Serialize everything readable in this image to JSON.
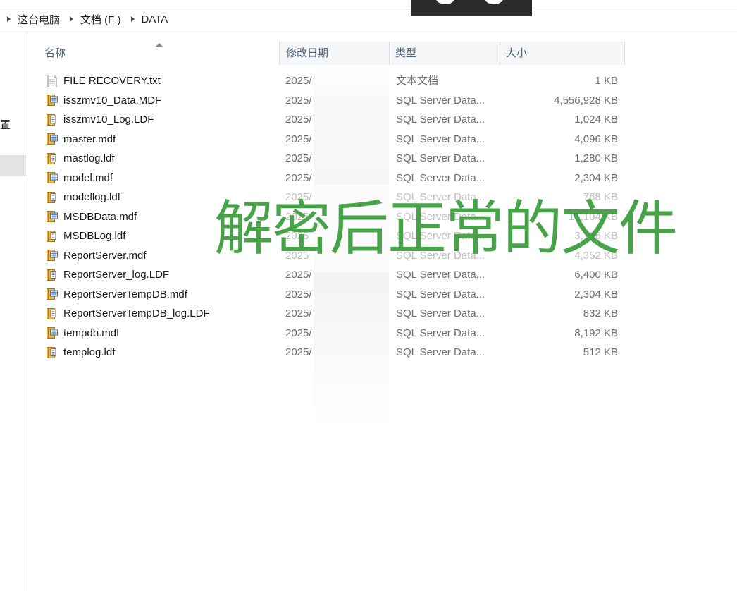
{
  "breadcrumb": [
    "这台电脑",
    "文档 (F:)",
    "DATA"
  ],
  "nav": {
    "partial_label": "置"
  },
  "columns": {
    "name": "名称",
    "date": "修改日期",
    "type": "类型",
    "size": "大小"
  },
  "files": [
    {
      "name": "FILE RECOVERY.txt",
      "date": "2025/",
      "type": "文本文档",
      "size": "1 KB",
      "icon": "text-file-icon"
    },
    {
      "name": "isszmv10_Data.MDF",
      "date": "2025/",
      "type": "SQL Server Data...",
      "size": "4,556,928 KB",
      "icon": "sql-data-file-icon"
    },
    {
      "name": "isszmv10_Log.LDF",
      "date": "2025/",
      "type": "SQL Server Data...",
      "size": "1,024 KB",
      "icon": "sql-log-file-icon"
    },
    {
      "name": "master.mdf",
      "date": "2025/",
      "type": "SQL Server Data...",
      "size": "4,096 KB",
      "icon": "sql-data-file-icon"
    },
    {
      "name": "mastlog.ldf",
      "date": "2025/",
      "type": "SQL Server Data...",
      "size": "1,280 KB",
      "icon": "sql-log-file-icon"
    },
    {
      "name": "model.mdf",
      "date": "2025/",
      "type": "SQL Server Data...",
      "size": "2,304 KB",
      "icon": "sql-data-file-icon"
    },
    {
      "name": "modellog.ldf",
      "date": "2025/",
      "type": "SQL Server Data...",
      "size": "768 KB",
      "icon": "sql-log-file-icon"
    },
    {
      "name": "MSDBData.mdf",
      "date": "2025",
      "type": "SQL Server Data...",
      "size": "15,104 KB",
      "icon": "sql-data-file-icon"
    },
    {
      "name": "MSDBLog.ldf",
      "date": "2025",
      "type": "SQL Server Data...",
      "size": "3,136 KB",
      "icon": "sql-log-file-icon"
    },
    {
      "name": "ReportServer.mdf",
      "date": "2025",
      "type": "SQL Server Data...",
      "size": "4,352 KB",
      "icon": "sql-data-file-icon"
    },
    {
      "name": "ReportServer_log.LDF",
      "date": "2025/",
      "type": "SQL Server Data...",
      "size": "6,400 KB",
      "icon": "sql-log-file-icon"
    },
    {
      "name": "ReportServerTempDB.mdf",
      "date": "2025/",
      "type": "SQL Server Data...",
      "size": "2,304 KB",
      "icon": "sql-data-file-icon"
    },
    {
      "name": "ReportServerTempDB_log.LDF",
      "date": "2025/",
      "type": "SQL Server Data...",
      "size": "832 KB",
      "icon": "sql-log-file-icon"
    },
    {
      "name": "tempdb.mdf",
      "date": "2025/",
      "type": "SQL Server Data...",
      "size": "8,192 KB",
      "icon": "sql-data-file-icon"
    },
    {
      "name": "templog.ldf",
      "date": "2025/",
      "type": "SQL Server Data...",
      "size": "512 KB",
      "icon": "sql-log-file-icon"
    }
  ],
  "overlay_caption": "解密后正常的文件",
  "colors": {
    "caption": "#47a249",
    "header_text": "#4c607a",
    "secondary_text": "#6d6d6d"
  }
}
